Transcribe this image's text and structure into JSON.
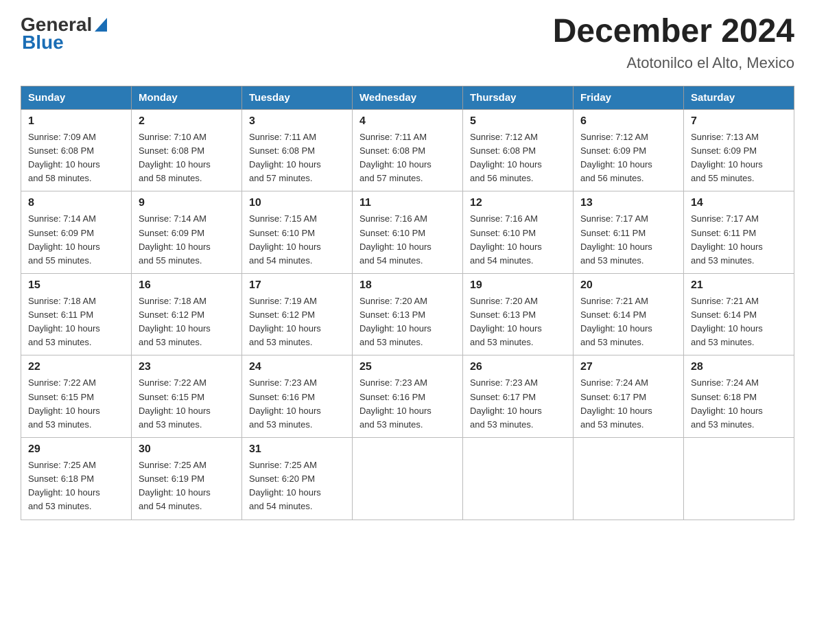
{
  "header": {
    "logo": {
      "general": "General",
      "blue": "Blue",
      "triangle": "▶"
    },
    "title": "December 2024",
    "location": "Atotonilco el Alto, Mexico"
  },
  "days_of_week": [
    "Sunday",
    "Monday",
    "Tuesday",
    "Wednesday",
    "Thursday",
    "Friday",
    "Saturday"
  ],
  "weeks": [
    [
      {
        "day": "1",
        "sunrise": "7:09 AM",
        "sunset": "6:08 PM",
        "daylight": "10 hours and 58 minutes."
      },
      {
        "day": "2",
        "sunrise": "7:10 AM",
        "sunset": "6:08 PM",
        "daylight": "10 hours and 58 minutes."
      },
      {
        "day": "3",
        "sunrise": "7:11 AM",
        "sunset": "6:08 PM",
        "daylight": "10 hours and 57 minutes."
      },
      {
        "day": "4",
        "sunrise": "7:11 AM",
        "sunset": "6:08 PM",
        "daylight": "10 hours and 57 minutes."
      },
      {
        "day": "5",
        "sunrise": "7:12 AM",
        "sunset": "6:08 PM",
        "daylight": "10 hours and 56 minutes."
      },
      {
        "day": "6",
        "sunrise": "7:12 AM",
        "sunset": "6:09 PM",
        "daylight": "10 hours and 56 minutes."
      },
      {
        "day": "7",
        "sunrise": "7:13 AM",
        "sunset": "6:09 PM",
        "daylight": "10 hours and 55 minutes."
      }
    ],
    [
      {
        "day": "8",
        "sunrise": "7:14 AM",
        "sunset": "6:09 PM",
        "daylight": "10 hours and 55 minutes."
      },
      {
        "day": "9",
        "sunrise": "7:14 AM",
        "sunset": "6:09 PM",
        "daylight": "10 hours and 55 minutes."
      },
      {
        "day": "10",
        "sunrise": "7:15 AM",
        "sunset": "6:10 PM",
        "daylight": "10 hours and 54 minutes."
      },
      {
        "day": "11",
        "sunrise": "7:16 AM",
        "sunset": "6:10 PM",
        "daylight": "10 hours and 54 minutes."
      },
      {
        "day": "12",
        "sunrise": "7:16 AM",
        "sunset": "6:10 PM",
        "daylight": "10 hours and 54 minutes."
      },
      {
        "day": "13",
        "sunrise": "7:17 AM",
        "sunset": "6:11 PM",
        "daylight": "10 hours and 53 minutes."
      },
      {
        "day": "14",
        "sunrise": "7:17 AM",
        "sunset": "6:11 PM",
        "daylight": "10 hours and 53 minutes."
      }
    ],
    [
      {
        "day": "15",
        "sunrise": "7:18 AM",
        "sunset": "6:11 PM",
        "daylight": "10 hours and 53 minutes."
      },
      {
        "day": "16",
        "sunrise": "7:18 AM",
        "sunset": "6:12 PM",
        "daylight": "10 hours and 53 minutes."
      },
      {
        "day": "17",
        "sunrise": "7:19 AM",
        "sunset": "6:12 PM",
        "daylight": "10 hours and 53 minutes."
      },
      {
        "day": "18",
        "sunrise": "7:20 AM",
        "sunset": "6:13 PM",
        "daylight": "10 hours and 53 minutes."
      },
      {
        "day": "19",
        "sunrise": "7:20 AM",
        "sunset": "6:13 PM",
        "daylight": "10 hours and 53 minutes."
      },
      {
        "day": "20",
        "sunrise": "7:21 AM",
        "sunset": "6:14 PM",
        "daylight": "10 hours and 53 minutes."
      },
      {
        "day": "21",
        "sunrise": "7:21 AM",
        "sunset": "6:14 PM",
        "daylight": "10 hours and 53 minutes."
      }
    ],
    [
      {
        "day": "22",
        "sunrise": "7:22 AM",
        "sunset": "6:15 PM",
        "daylight": "10 hours and 53 minutes."
      },
      {
        "day": "23",
        "sunrise": "7:22 AM",
        "sunset": "6:15 PM",
        "daylight": "10 hours and 53 minutes."
      },
      {
        "day": "24",
        "sunrise": "7:23 AM",
        "sunset": "6:16 PM",
        "daylight": "10 hours and 53 minutes."
      },
      {
        "day": "25",
        "sunrise": "7:23 AM",
        "sunset": "6:16 PM",
        "daylight": "10 hours and 53 minutes."
      },
      {
        "day": "26",
        "sunrise": "7:23 AM",
        "sunset": "6:17 PM",
        "daylight": "10 hours and 53 minutes."
      },
      {
        "day": "27",
        "sunrise": "7:24 AM",
        "sunset": "6:17 PM",
        "daylight": "10 hours and 53 minutes."
      },
      {
        "day": "28",
        "sunrise": "7:24 AM",
        "sunset": "6:18 PM",
        "daylight": "10 hours and 53 minutes."
      }
    ],
    [
      {
        "day": "29",
        "sunrise": "7:25 AM",
        "sunset": "6:18 PM",
        "daylight": "10 hours and 53 minutes."
      },
      {
        "day": "30",
        "sunrise": "7:25 AM",
        "sunset": "6:19 PM",
        "daylight": "10 hours and 54 minutes."
      },
      {
        "day": "31",
        "sunrise": "7:25 AM",
        "sunset": "6:20 PM",
        "daylight": "10 hours and 54 minutes."
      },
      null,
      null,
      null,
      null
    ]
  ],
  "labels": {
    "sunrise": "Sunrise:",
    "sunset": "Sunset:",
    "daylight": "Daylight:"
  }
}
